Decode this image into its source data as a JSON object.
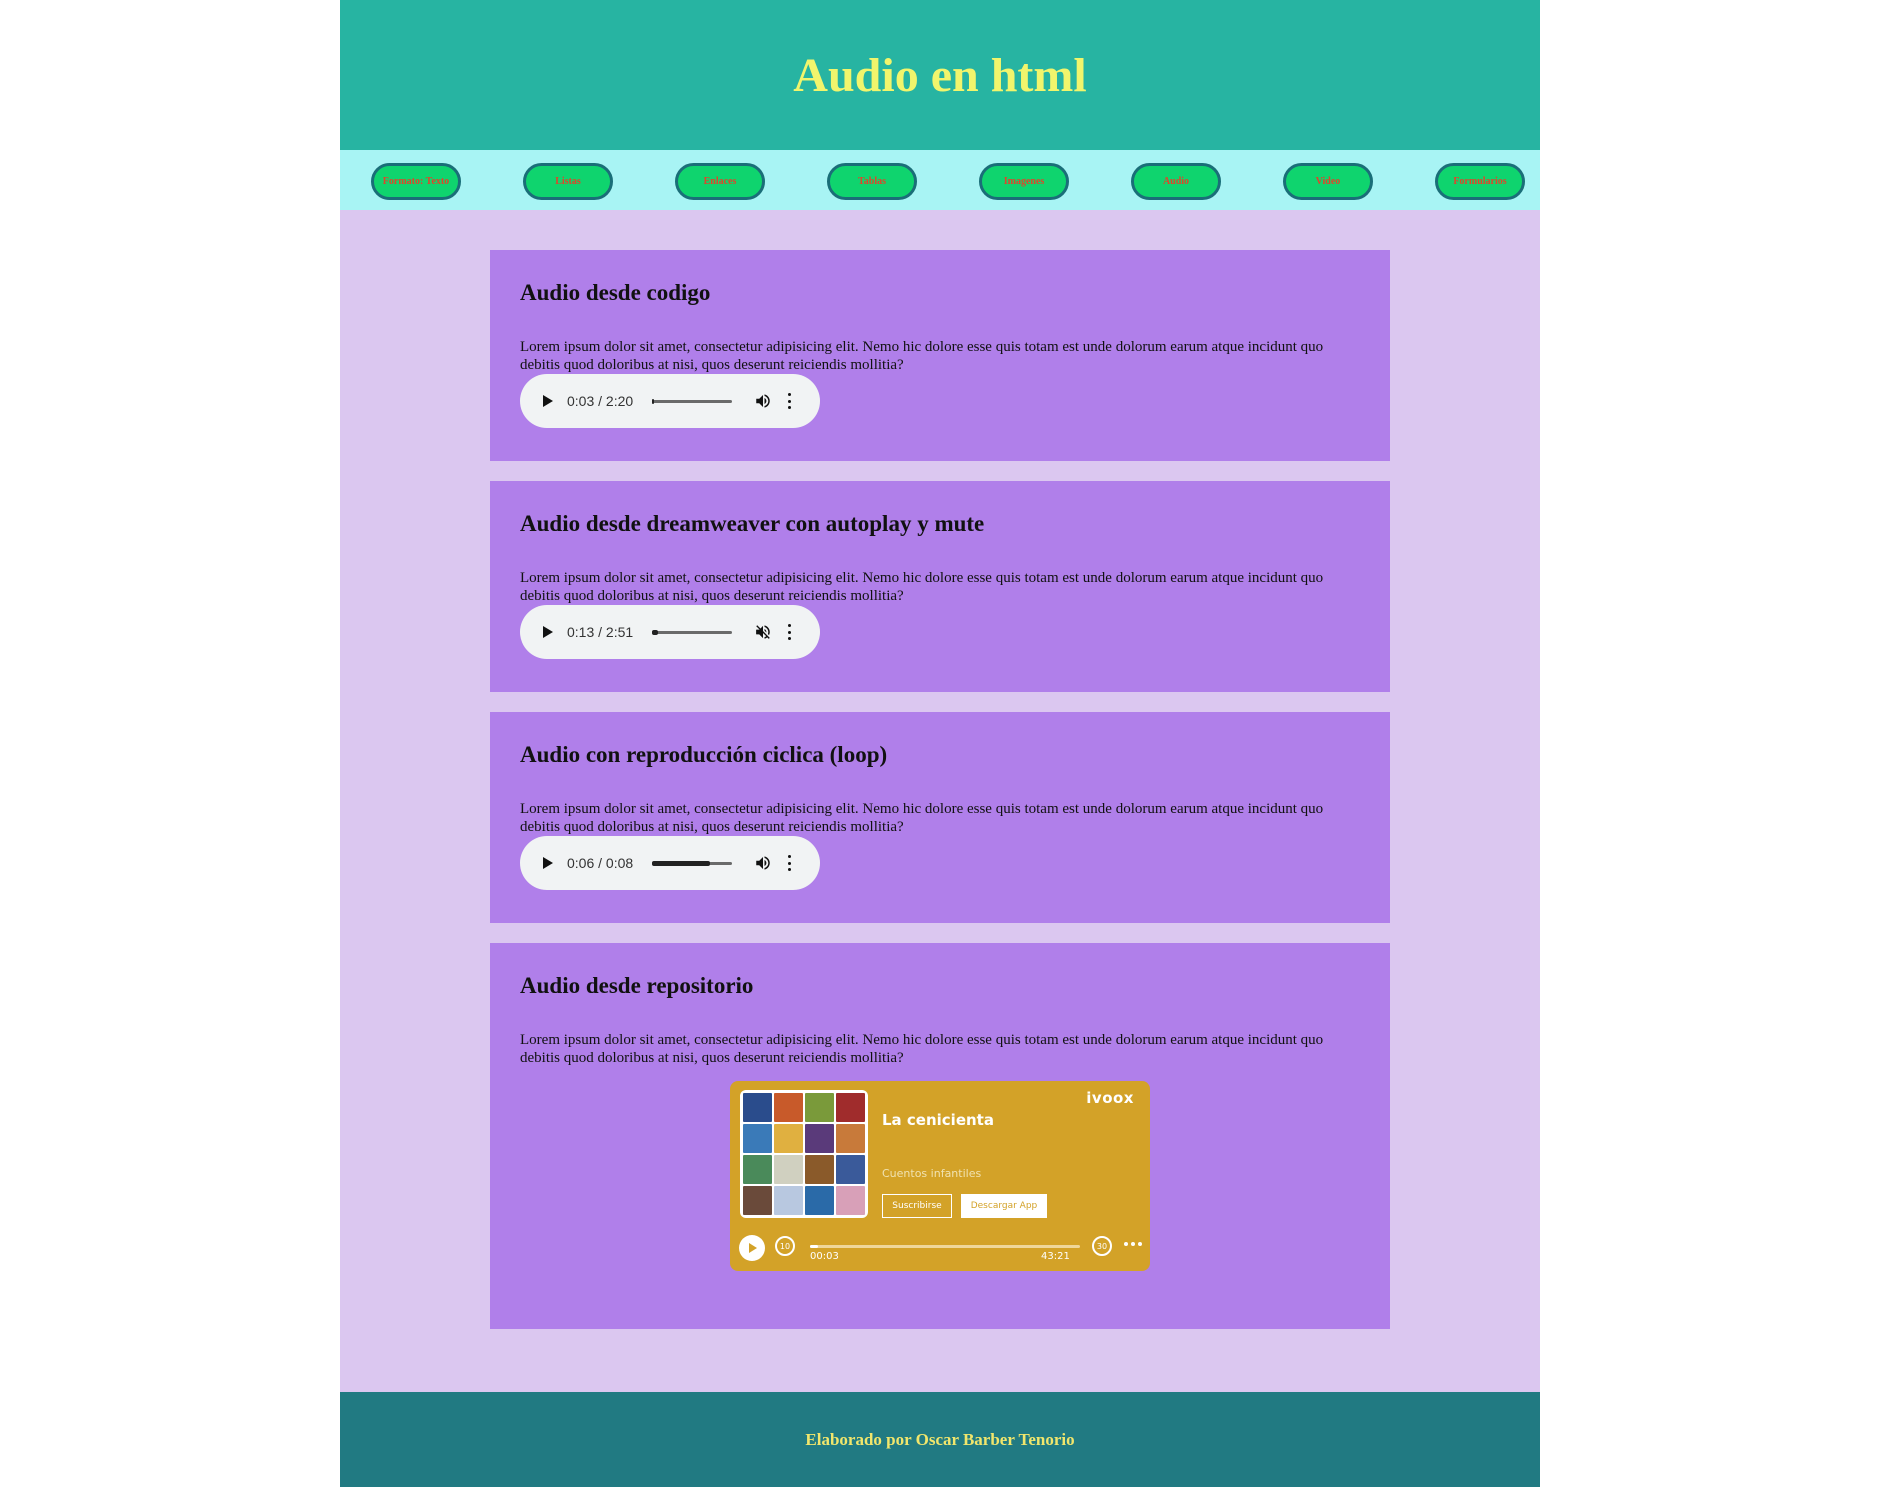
{
  "header": {
    "title": "Audio en html"
  },
  "nav": {
    "items": [
      {
        "label": "Formato: Texto"
      },
      {
        "label": "Listas"
      },
      {
        "label": "Enlaces"
      },
      {
        "label": "Tablas"
      },
      {
        "label": "Imagenes"
      },
      {
        "label": "Audio"
      },
      {
        "label": "Video"
      },
      {
        "label": "Formularios"
      }
    ]
  },
  "sections": [
    {
      "title": "Audio desde codigo",
      "text": "Lorem ipsum dolor sit amet, consectetur adipisicing elit. Nemo hic dolore esse quis totam est unde dolorum earum atque incidunt quo debitis quod doloribus at nisi, quos deserunt reiciendis mollitia?",
      "player": {
        "time": "0:03 / 2:20",
        "progress": 0.02,
        "muted": false
      }
    },
    {
      "title": "Audio desde dreamweaver con autoplay y mute",
      "text": "Lorem ipsum dolor sit amet, consectetur adipisicing elit. Nemo hic dolore esse quis totam est unde dolorum earum atque incidunt quo debitis quod doloribus at nisi, quos deserunt reiciendis mollitia?",
      "player": {
        "time": "0:13 / 2:51",
        "progress": 0.08,
        "muted": true
      }
    },
    {
      "title": "Audio con reproducción ciclica (loop)",
      "text": "Lorem ipsum dolor sit amet, consectetur adipisicing elit. Nemo hic dolore esse quis totam est unde dolorum earum atque incidunt quo debitis quod doloribus at nisi, quos deserunt reiciendis mollitia?",
      "player": {
        "time": "0:06 / 0:08",
        "progress": 0.73,
        "muted": false
      }
    },
    {
      "title": "Audio desde repositorio",
      "text": "Lorem ipsum dolor sit amet, consectetur adipisicing elit. Nemo hic dolore esse quis totam est unde dolorum earum atque incidunt quo debitis quod doloribus at nisi, quos deserunt reiciendis mollitia?"
    }
  ],
  "ivoox": {
    "logo": "ivoox",
    "title": "La cenicienta",
    "subtitle": "Cuentos infantiles",
    "subscribe_label": "Suscribirse",
    "app_label": "Descargar App",
    "back_label": "10",
    "forward_label": "30",
    "time_start": "00:03",
    "time_end": "43:21",
    "progress": 0.001,
    "accent": "#d3a228"
  },
  "footer": {
    "text": "Elaborado por Oscar Barber Tenorio"
  },
  "colors": {
    "header_bg": "#27b4a2",
    "title": "#f1f56c",
    "nav_bg": "#a8f4f4",
    "nav_button": "#0fd46e",
    "page_bg": "#dbc7f0",
    "card_bg": "#b07fea",
    "footer_bg": "#217a82"
  }
}
